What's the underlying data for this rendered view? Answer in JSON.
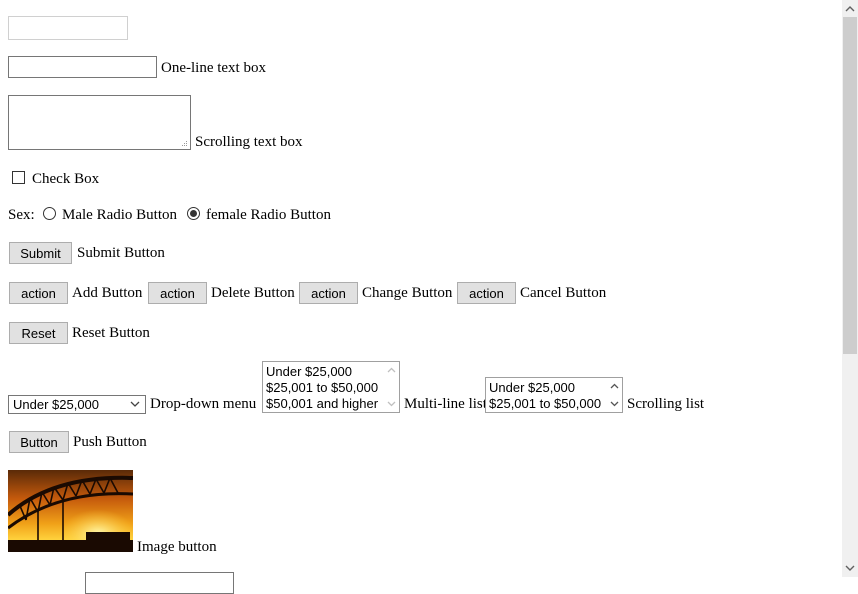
{
  "form": {
    "one_line_label": "One-line text box",
    "scrolling_text_label": "Scrolling text box",
    "checkbox_label": "Check Box",
    "sex_label": "Sex:",
    "radio_male_label": "Male Radio Button",
    "radio_female_label": "female Radio Button",
    "radio_selected": "female",
    "submit_button": "Submit",
    "submit_label": "Submit Button",
    "action_buttons": [
      {
        "button": "action",
        "label": "Add Button"
      },
      {
        "button": "action",
        "label": "Delete Button"
      },
      {
        "button": "action",
        "label": "Change Button"
      },
      {
        "button": "action",
        "label": "Cancel Button"
      }
    ],
    "reset_button": "Reset",
    "reset_label": "Reset Button",
    "dropdown_value": "Under $25,000",
    "dropdown_label": "Drop-down menu",
    "multiline_options": [
      "Under $25,000",
      "$25,001 to $50,000",
      "$50,001 and higher"
    ],
    "multiline_label": "Multi-line list",
    "scrolling_options": [
      "Under $25,000",
      "$25,001 to $50,000"
    ],
    "scrolling_label": "Scrolling list",
    "push_button": "Button",
    "push_label": "Push Button",
    "image_button_label": "Image button"
  }
}
